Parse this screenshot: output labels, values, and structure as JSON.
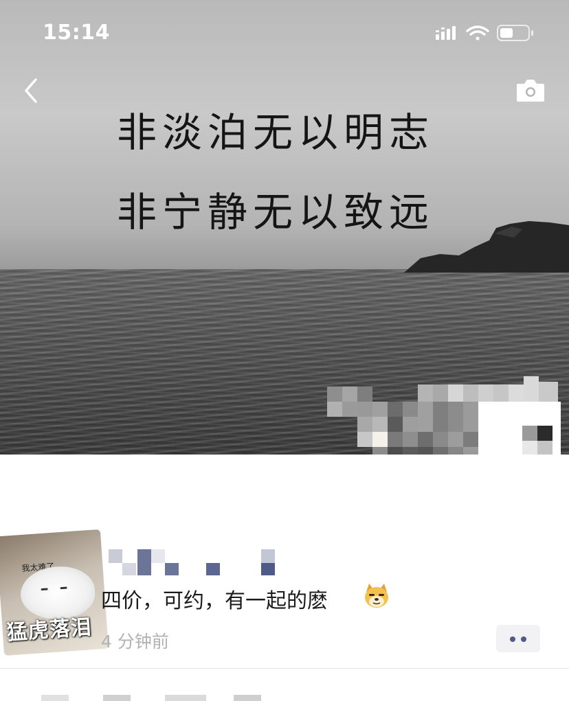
{
  "status_bar": {
    "time": "15:14"
  },
  "cover": {
    "quote_line_1": "非淡泊无以明志",
    "quote_line_2": "非宁静无以致远"
  },
  "navigation": {
    "back_icon": "chevron-left-icon",
    "camera_icon": "camera-icon"
  },
  "profile": {
    "avatar_caption_small": "我太难了",
    "avatar_caption_big": "猛虎落泪"
  },
  "post": {
    "text": "四价，可约，有一起的麽",
    "emoji": "doge-emoji",
    "time": "4 分钟前",
    "more_icon": "more-dots-icon"
  },
  "colors": {
    "link_blue": "#4e5b84",
    "time_gray": "#b2b2b2",
    "more_bg": "#f2f2f5"
  }
}
